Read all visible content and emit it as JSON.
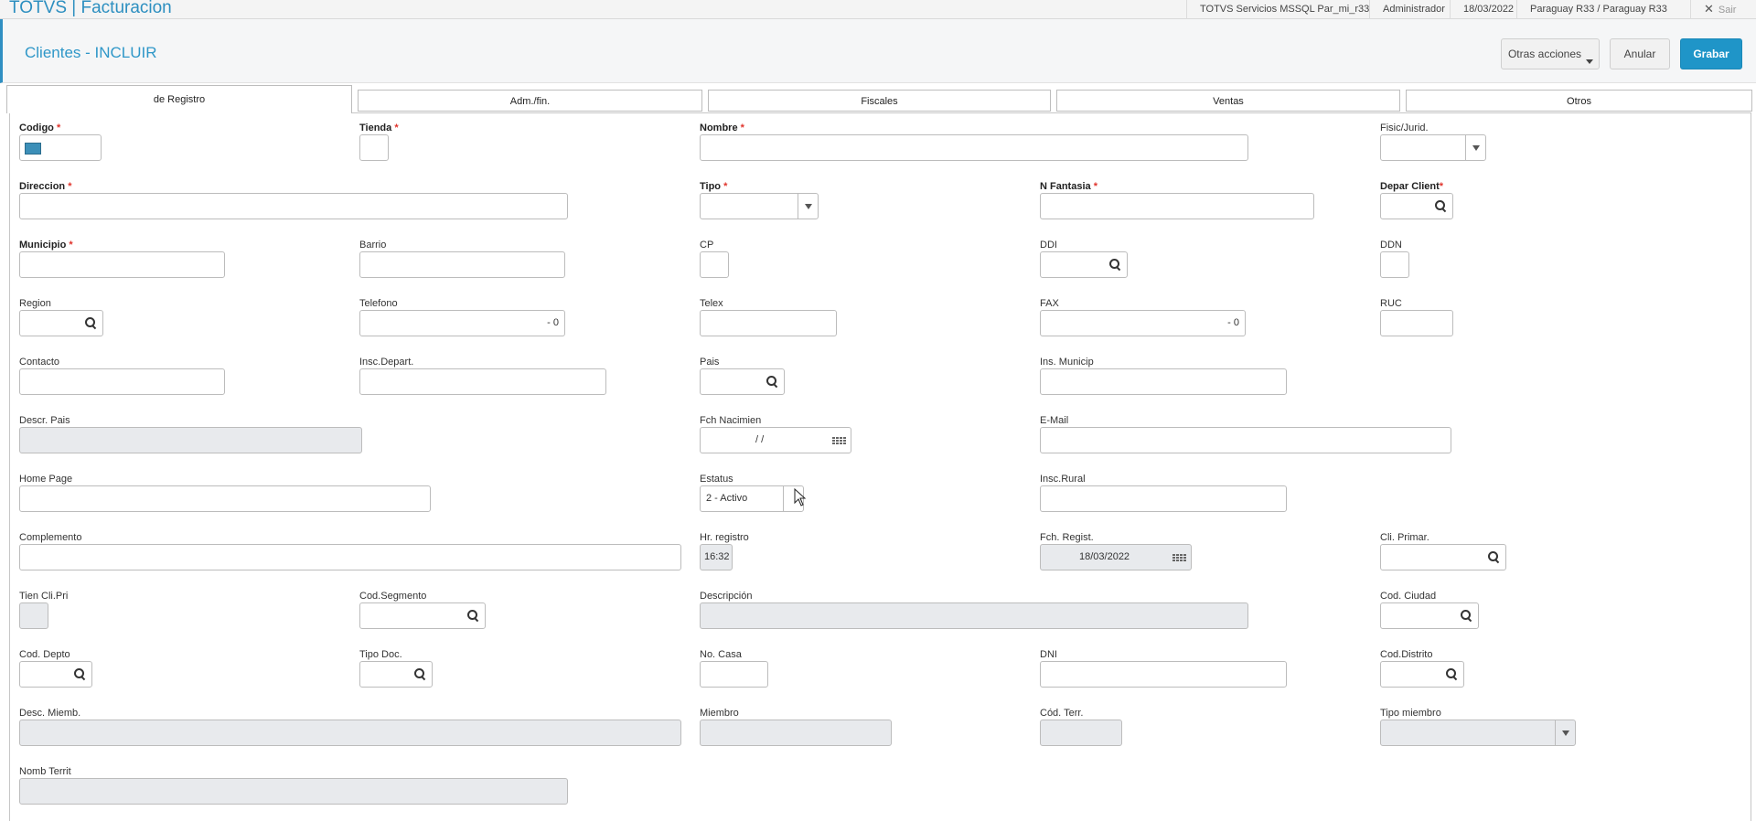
{
  "app": {
    "title": "TOTVS | Facturacion"
  },
  "topbar": {
    "environment": "TOTVS Servicios MSSQL Par_mi_r33",
    "user": "Administrador",
    "date": "18/03/2022",
    "branch": "Paraguay R33 / Paraguay R33",
    "logout": "Sair"
  },
  "header": {
    "title": "Clientes - INCLUIR",
    "more_actions": "Otras acciones",
    "cancel": "Anular",
    "save": "Grabar"
  },
  "tabs": [
    "de Registro",
    "Adm./fin.",
    "Fiscales",
    "Ventas",
    "Otros"
  ],
  "fields": {
    "codigo": {
      "label": "Codigo",
      "value": ""
    },
    "tienda": {
      "label": "Tienda",
      "value": ""
    },
    "nombre": {
      "label": "Nombre",
      "value": ""
    },
    "fisic_jurid": {
      "label": "Fisic/Jurid.",
      "value": ""
    },
    "direccion": {
      "label": "Direccion",
      "value": ""
    },
    "tipo": {
      "label": "Tipo",
      "value": ""
    },
    "n_fantasia": {
      "label": "N Fantasia",
      "value": ""
    },
    "depar_client": {
      "label": "Depar Client",
      "value": ""
    },
    "municipio": {
      "label": "Municipio",
      "value": ""
    },
    "barrio": {
      "label": "Barrio",
      "value": ""
    },
    "cp": {
      "label": "CP",
      "value": ""
    },
    "ddi": {
      "label": "DDI",
      "value": ""
    },
    "ddn": {
      "label": "DDN",
      "value": ""
    },
    "region": {
      "label": "Region",
      "value": ""
    },
    "telefono": {
      "label": "Telefono",
      "value": "-  0"
    },
    "telex": {
      "label": "Telex",
      "value": ""
    },
    "fax": {
      "label": "FAX",
      "value": "-  0"
    },
    "ruc": {
      "label": "RUC",
      "value": ""
    },
    "contacto": {
      "label": "Contacto",
      "value": ""
    },
    "insc_depart": {
      "label": "Insc.Depart.",
      "value": ""
    },
    "pais": {
      "label": "Pais",
      "value": ""
    },
    "ins_municip": {
      "label": "Ins. Municip",
      "value": ""
    },
    "descr_pais": {
      "label": "Descr. Pais",
      "value": ""
    },
    "fch_nacimien": {
      "label": "Fch Nacimien",
      "value": "/  /"
    },
    "email": {
      "label": "E-Mail",
      "value": ""
    },
    "home_page": {
      "label": "Home Page",
      "value": ""
    },
    "estatus": {
      "label": "Estatus",
      "value": "2 - Activo"
    },
    "insc_rural": {
      "label": "Insc.Rural",
      "value": ""
    },
    "complemento": {
      "label": "Complemento",
      "value": ""
    },
    "hr_registro": {
      "label": "Hr. registro",
      "value": "16:32"
    },
    "fch_regist": {
      "label": "Fch. Regist.",
      "value": "18/03/2022"
    },
    "cli_primar": {
      "label": "Cli. Primar.",
      "value": ""
    },
    "tien_cli_pri": {
      "label": "Tien Cli.Pri",
      "value": ""
    },
    "cod_segmento": {
      "label": "Cod.Segmento",
      "value": ""
    },
    "descripcion": {
      "label": "Descripción",
      "value": ""
    },
    "cod_ciudad": {
      "label": "Cod. Ciudad",
      "value": ""
    },
    "cod_depto": {
      "label": "Cod. Depto",
      "value": ""
    },
    "tipo_doc": {
      "label": "Tipo Doc.",
      "value": ""
    },
    "no_casa": {
      "label": "No. Casa",
      "value": ""
    },
    "dni": {
      "label": "DNI",
      "value": ""
    },
    "cod_distrito": {
      "label": "Cod.Distrito",
      "value": ""
    },
    "desc_miemb": {
      "label": "Desc. Miemb.",
      "value": ""
    },
    "miembro": {
      "label": "Miembro",
      "value": ""
    },
    "cod_terr": {
      "label": "Cód. Terr.",
      "value": ""
    },
    "tipo_miembro": {
      "label": "Tipo miembro",
      "value": ""
    },
    "nomb_territ": {
      "label": "Nomb Territ",
      "value": ""
    }
  },
  "colors": {
    "accent": "#2f97c8",
    "primary_button": "#1f95c8",
    "required": "#e0342c",
    "readonly_bg": "#e8eaed"
  }
}
